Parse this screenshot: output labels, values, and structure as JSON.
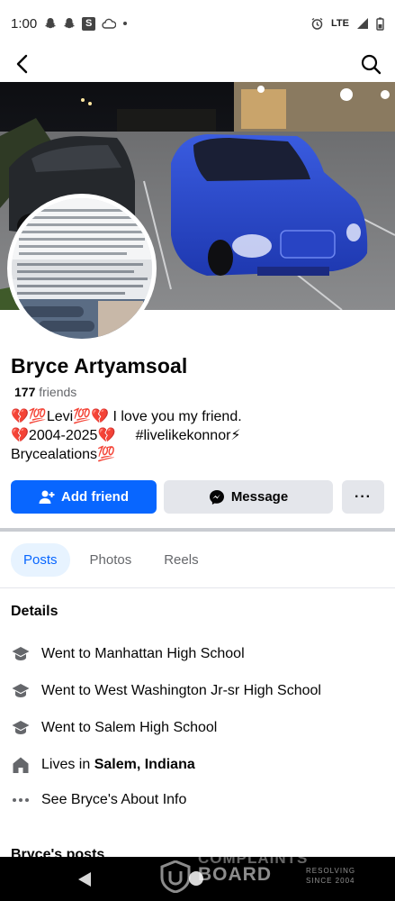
{
  "status_bar": {
    "time": "1:00",
    "network": "LTE"
  },
  "profile": {
    "name": "Bryce Artyamsoal",
    "friends_count": "177",
    "friends_label": "friends",
    "bio": "💔💯Levi💯💔 I love you my friend.\n💔2004-2025💔     #livelikekonnor⚡\nBrycealations💯"
  },
  "actions": {
    "add_friend": "Add friend",
    "message": "Message",
    "more": "···"
  },
  "tabs": [
    "Posts",
    "Photos",
    "Reels"
  ],
  "details": {
    "title": "Details",
    "items": [
      {
        "icon": "school-icon",
        "text": "Went to Manhattan High School"
      },
      {
        "icon": "school-icon",
        "text": "Went to West Washington Jr-sr High School"
      },
      {
        "icon": "school-icon",
        "text": "Went to Salem High School"
      },
      {
        "icon": "home-icon",
        "prefix": "Lives in ",
        "bold": "Salem, Indiana"
      },
      {
        "icon": "more-icon",
        "text": "See Bryce's About Info"
      }
    ]
  },
  "posts_heading": "Bryce's posts",
  "watermark": {
    "top": "COMPLAINTS",
    "main": "BOARD",
    "side_1": "RESOLVING",
    "side_2": "SINCE 2004"
  },
  "colors": {
    "accent": "#0866ff",
    "accent_light": "#e7f3ff",
    "secondary_button": "#e4e6eb",
    "muted_text": "#65676b"
  }
}
